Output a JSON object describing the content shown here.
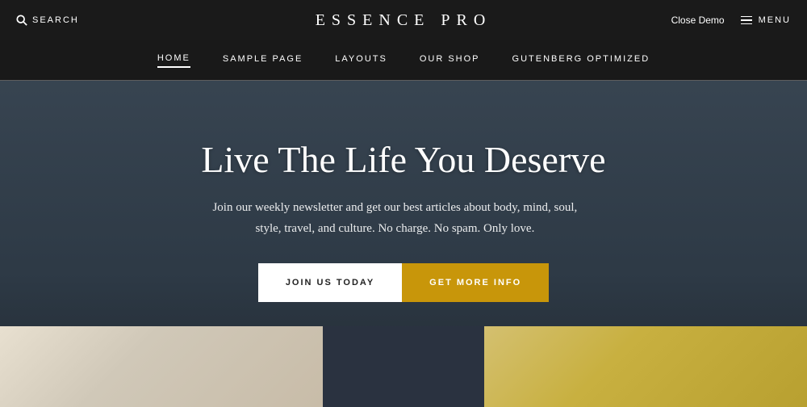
{
  "topbar": {
    "search_label": "SEARCH",
    "site_title": "ESSENCE PRO",
    "close_demo_label": "Close Demo",
    "menu_label": "MENU"
  },
  "nav": {
    "items": [
      {
        "label": "HOME",
        "active": true
      },
      {
        "label": "SAMPLE PAGE",
        "active": false
      },
      {
        "label": "LAYOUTS",
        "active": false
      },
      {
        "label": "OUR SHOP",
        "active": false
      },
      {
        "label": "GUTENBERG OPTIMIZED",
        "active": false
      }
    ]
  },
  "hero": {
    "heading": "Live The Life You Deserve",
    "subtext_line1": "Join our weekly newsletter and get our best articles about body, mind, soul,",
    "subtext_line2": "style, travel, and culture. No charge. No spam. Only love.",
    "btn_join": "JOIN US TODAY",
    "btn_info": "GET MORE INFO",
    "colors": {
      "btn_info_bg": "#c8960a",
      "btn_join_bg": "#ffffff"
    }
  }
}
